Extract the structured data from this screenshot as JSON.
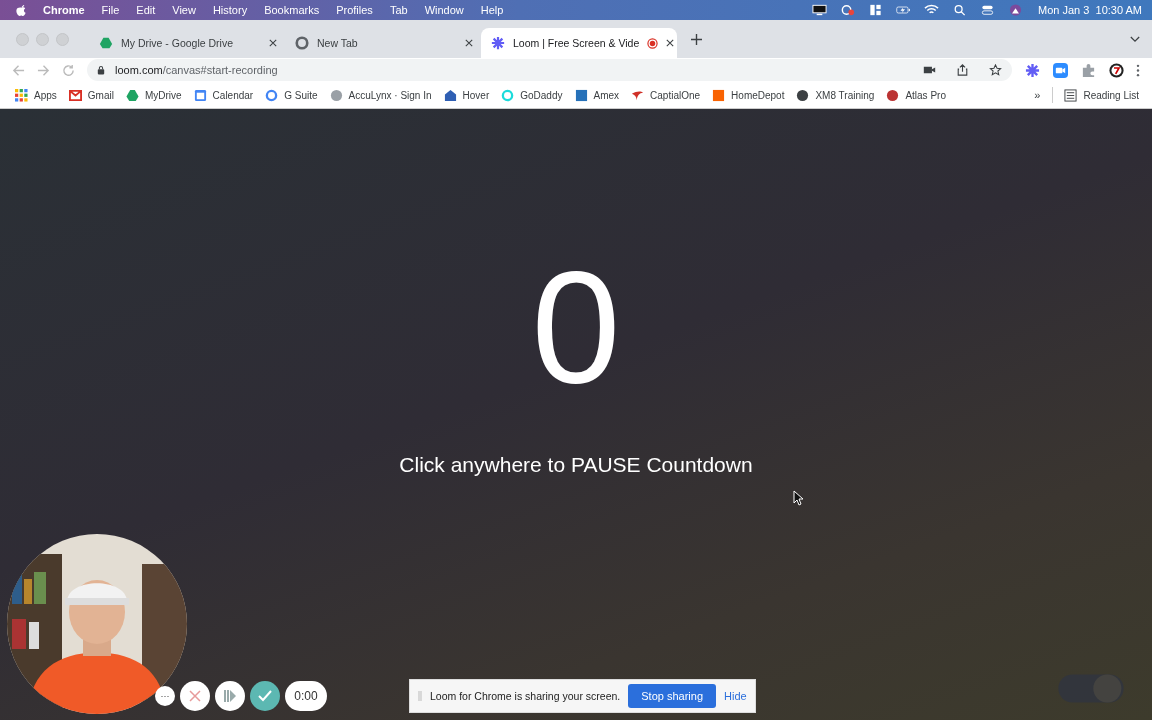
{
  "menu_bar": {
    "app": "Chrome",
    "menus": [
      "File",
      "Edit",
      "View",
      "History",
      "Bookmarks",
      "Profiles",
      "Tab",
      "Window",
      "Help"
    ],
    "clock": "Mon Jan 3  10:30 AM"
  },
  "tabs": [
    {
      "title": "My Drive - Google Drive",
      "selected": false,
      "kind": "drive",
      "recording": false
    },
    {
      "title": "New Tab",
      "selected": false,
      "kind": "chrome",
      "recording": false
    },
    {
      "title": "Loom | Free Screen & Vide",
      "selected": true,
      "kind": "loom",
      "recording": true
    }
  ],
  "address": {
    "host": "loom.com",
    "path": "/canvas#start-recording"
  },
  "bookmarks": [
    {
      "label": "Apps",
      "kind": "apps"
    },
    {
      "label": "Gmail",
      "kind": "gmail"
    },
    {
      "label": "MyDrive",
      "kind": "drive"
    },
    {
      "label": "Calendar",
      "kind": "calendar"
    },
    {
      "label": "G Suite",
      "kind": "gsuite"
    },
    {
      "label": "AccuLynx · Sign In",
      "kind": "acculynx"
    },
    {
      "label": "Hover",
      "kind": "hover"
    },
    {
      "label": "GoDaddy",
      "kind": "godaddy"
    },
    {
      "label": "Amex",
      "kind": "amex"
    },
    {
      "label": "CaptialOne",
      "kind": "capitalone"
    },
    {
      "label": "HomeDepot",
      "kind": "homedepot"
    },
    {
      "label": "XM8 Training",
      "kind": "globe"
    },
    {
      "label": "Atlas Pro",
      "kind": "atlas"
    }
  ],
  "bookmarks_overflow": "»",
  "reading_list": "Reading List",
  "countdown": {
    "number": "0",
    "hint": "Click anywhere to PAUSE Countdown"
  },
  "recorder": {
    "more": "···",
    "timer": "0:00"
  },
  "share_bar": {
    "message": "Loom for Chrome is sharing your screen.",
    "stop": "Stop sharing",
    "hide": "Hide"
  }
}
